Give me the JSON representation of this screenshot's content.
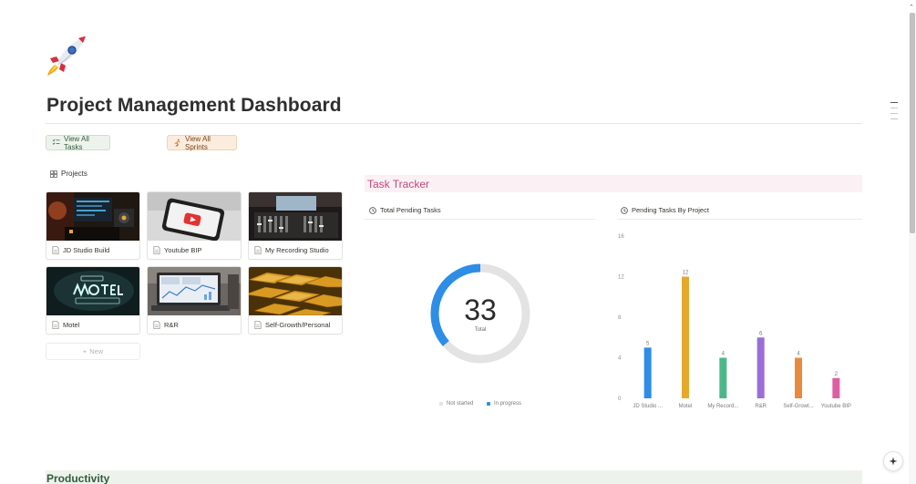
{
  "page": {
    "title": "Project Management Dashboard",
    "icon": "rocket-icon"
  },
  "buttons": {
    "view_all_tasks": "View All Tasks",
    "view_all_sprints": "View All Sprints"
  },
  "projects": {
    "heading": "Projects",
    "items": [
      {
        "label": "JD Studio Build"
      },
      {
        "label": "Youtube BIP"
      },
      {
        "label": "My Recording Studio"
      },
      {
        "label": "Motel"
      },
      {
        "label": "R&R"
      },
      {
        "label": "Self-Growth/Personal"
      }
    ],
    "new_label": "New"
  },
  "task_tracker": {
    "title": "Task Tracker",
    "total_widget": {
      "heading": "Total Pending Tasks",
      "total": "33",
      "total_label": "Total",
      "legend": [
        "Not started",
        "In progress"
      ]
    },
    "by_project_widget": {
      "heading": "Pending Tasks By Project"
    }
  },
  "chart_data": [
    {
      "type": "pie",
      "title": "Total Pending Tasks",
      "center_value": 33,
      "center_label": "Total",
      "series": [
        {
          "name": "Not started",
          "values": [
            21
          ]
        },
        {
          "name": "In progress",
          "values": [
            12
          ]
        }
      ],
      "colors": [
        "#e3e3e3",
        "#2e8de6"
      ],
      "legend_position": "bottom"
    },
    {
      "type": "bar",
      "title": "Pending Tasks By Project",
      "categories": [
        "JD Studio ...",
        "Motel",
        "My Record...",
        "R&R",
        "Self-Growt...",
        "Youtube BIP"
      ],
      "values": [
        5,
        12,
        4,
        6,
        4,
        2
      ],
      "colors": [
        "#2e8de6",
        "#e4a92b",
        "#4cb88a",
        "#9a6dd7",
        "#e8893d",
        "#dd5fa2"
      ],
      "yticks": [
        "0",
        "4",
        "8",
        "12",
        "16"
      ],
      "ylim": [
        0,
        16
      ],
      "grid": false
    }
  ],
  "sections": {
    "productivity": "Productivity"
  },
  "colors": {
    "tasks_button_bg": "#edf3ec",
    "sprints_button_bg": "#fbecdd",
    "tracker_accent": "#c4477b",
    "productivity_bg": "#edf3ec"
  }
}
